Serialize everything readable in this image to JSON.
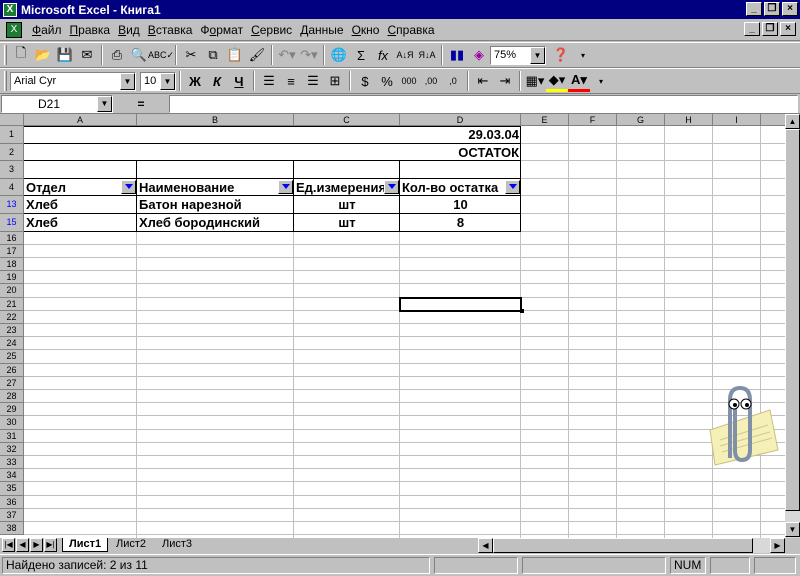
{
  "window": {
    "title": "Microsoft Excel - Книга1"
  },
  "menu": [
    "Файл",
    "Правка",
    "Вид",
    "Вставка",
    "Формат",
    "Сервис",
    "Данные",
    "Окно",
    "Справка"
  ],
  "menu_underline": [
    "Ф",
    "П",
    "В",
    "В",
    "о",
    "С",
    "Д",
    "О",
    "С"
  ],
  "toolbar": {
    "zoom": "75%"
  },
  "format": {
    "font": "Arial Cyr",
    "size": "10",
    "bold": "Ж",
    "italic": "К",
    "underline": "Ч"
  },
  "formula_bar": {
    "name_box": "D21",
    "equals": "=",
    "content": ""
  },
  "columns": [
    "A",
    "B",
    "C",
    "D",
    "E",
    "F",
    "G",
    "H",
    "I"
  ],
  "rows": [
    "1",
    "2",
    "3",
    "4",
    "13",
    "15",
    "16",
    "17",
    "18",
    "19",
    "20",
    "21",
    "22",
    "23",
    "24",
    "25",
    "26",
    "27",
    "28",
    "29",
    "30",
    "31",
    "32",
    "33",
    "34",
    "35",
    "36",
    "37",
    "38"
  ],
  "cells": {
    "D1": "29.03.04",
    "D2": "ОСТАТОК",
    "A4": "Отдел",
    "B4": "Наименование",
    "C4": "Ед.измерения",
    "D4": "Кол-во остатка",
    "A13": "Хлеб",
    "B13": "Батон нарезной",
    "C13": "шт",
    "D13": "10",
    "A15": "Хлеб",
    "B15": "Хлеб бородинский",
    "C15": "шт",
    "D15": "8"
  },
  "tabs": [
    "Лист1",
    "Лист2",
    "Лист3"
  ],
  "active_tab": "Лист1",
  "status": {
    "text": "Найдено записей: 2 из 11",
    "num": "NUM"
  },
  "colors": {
    "title_bg": "#000080",
    "face": "#c0c0c0",
    "filtered_row": "#0000ff"
  }
}
